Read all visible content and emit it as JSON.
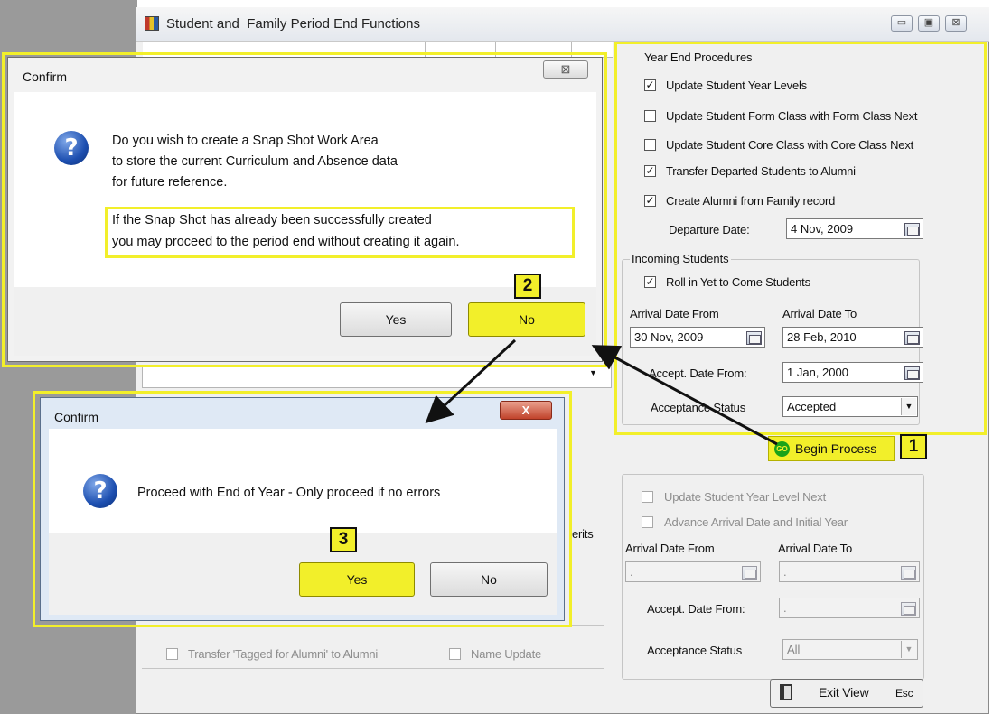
{
  "main_window": {
    "title": "Student and  Family Period End Functions",
    "minimize": "▭",
    "maximize": "▣",
    "close": "⊠"
  },
  "year_end": {
    "title": "Year End Procedures",
    "items": [
      {
        "label": "Update Student Year Levels",
        "checked": true
      },
      {
        "label": "Update Student Form Class with Form Class Next",
        "checked": false
      },
      {
        "label": "Update Student Core Class with Core Class Next",
        "checked": false
      },
      {
        "label": "Transfer Departed Students to Alumni",
        "checked": true
      },
      {
        "label": "Create Alumni from Family record",
        "checked": true
      }
    ],
    "departure_label": "Departure Date:",
    "departure_value": "4 Nov, 2009"
  },
  "incoming": {
    "title": "Incoming Students",
    "roll_in_label": "Roll in Yet to Come Students",
    "roll_in_checked": true,
    "arrival_from_label": "Arrival Date From",
    "arrival_from_value": "30 Nov, 2009",
    "arrival_to_label": "Arrival Date To",
    "arrival_to_value": "28 Feb, 2010",
    "accept_label": "Accept. Date  From:",
    "accept_value": "1 Jan, 2000",
    "status_label": "Acceptance Status",
    "status_value": "Accepted"
  },
  "begin_process": {
    "label": "Begin Process",
    "icon_text": "GO"
  },
  "lower_panel": {
    "items": [
      {
        "label": "Update Student Year Level Next",
        "checked": false
      },
      {
        "label": "Advance Arrival Date and Initial Year",
        "checked": false
      }
    ],
    "arrival_from_label": "Arrival Date From",
    "arrival_from_value": "  .",
    "arrival_to_label": "Arrival Date To",
    "arrival_to_value": "  .",
    "accept_label": "Accept. Date  From:",
    "accept_value": "  .",
    "status_label": "Acceptance Status",
    "status_value": "All",
    "transfer_tagged": "Transfer 'Tagged for Alumni' to Alumni",
    "name_update": "Name Update",
    "partial_text": "erits"
  },
  "exit": {
    "label": "Exit View",
    "key": "Esc"
  },
  "dialog1": {
    "title": "Confirm",
    "close": "⊠",
    "line1": "Do you wish to create a Snap Shot Work Area",
    "line2": "to store the current Curriculum and Absence data",
    "line3": "for future reference.",
    "line4": "If the Snap Shot has already been successfully created",
    "line5": "you may proceed to the period end without creating it again.",
    "yes": "Yes",
    "no": "No"
  },
  "dialog2": {
    "title": "Confirm",
    "close": "X",
    "message": "Proceed with End of Year - Only proceed if no errors",
    "yes": "Yes",
    "no": "No"
  },
  "steps": [
    "1",
    "2",
    "3"
  ],
  "colors": {
    "highlight": "#f2ef2a",
    "go_green": "#19a319"
  }
}
